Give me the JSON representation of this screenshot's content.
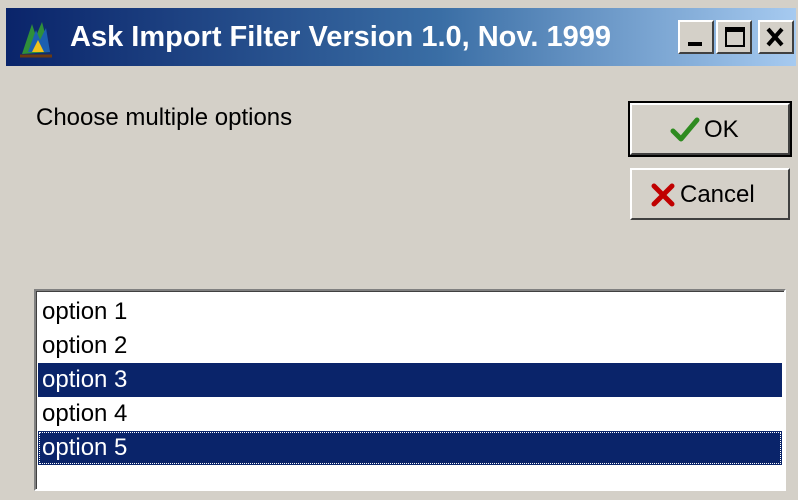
{
  "window": {
    "title": "Ask Import Filter Version 1.0, Nov. 1999",
    "icon": "application-icon",
    "controls": {
      "minimize_icon": "minimize-icon",
      "maximize_icon": "maximize-icon",
      "close_icon": "close-icon"
    }
  },
  "prompt": "Choose multiple options",
  "buttons": {
    "ok_label": "OK",
    "ok_icon": "checkmark-icon",
    "cancel_label": "Cancel",
    "cancel_icon": "x-icon"
  },
  "list": {
    "items": [
      {
        "label": "option 1",
        "selected": false
      },
      {
        "label": "option 2",
        "selected": false
      },
      {
        "label": "option 3",
        "selected": true
      },
      {
        "label": "option 4",
        "selected": false
      },
      {
        "label": "option 5",
        "selected": true,
        "focused": true
      }
    ]
  },
  "colors": {
    "face": "#d4d0c8",
    "title_start": "#0a246a",
    "title_end": "#a6caf0",
    "selection": "#0a246a",
    "ok_check": "#2e8b20",
    "cancel_x": "#c00000"
  }
}
